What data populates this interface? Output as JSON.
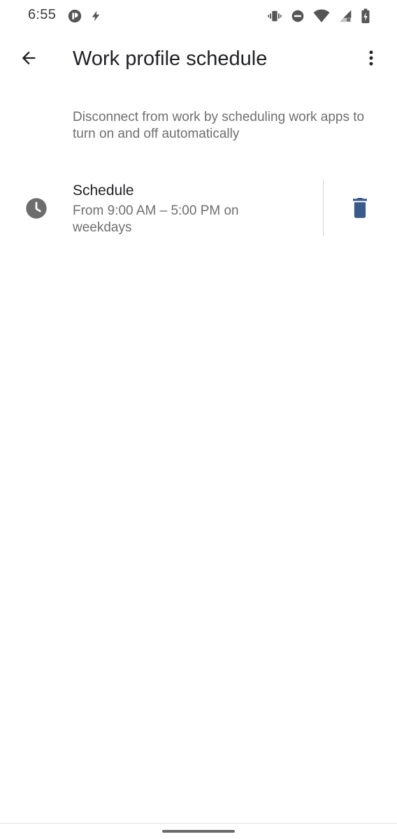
{
  "status_bar": {
    "time": "6:55",
    "left_icons": [
      "app-notification-icon",
      "flash-icon"
    ],
    "right_icons": [
      "vibrate-icon",
      "do-not-disturb-icon",
      "wifi-icon",
      "cell-signal-no-service-icon",
      "battery-charging-icon"
    ]
  },
  "app_bar": {
    "title": "Work profile schedule",
    "back_icon": "arrow-back-icon",
    "overflow_icon": "more-vert-icon"
  },
  "description": "Disconnect from work by scheduling work apps to turn on and off automatically",
  "schedule": {
    "icon": "clock-icon",
    "title": "Schedule",
    "summary": "From 9:00 AM – 5:00 PM on weekdays",
    "delete_icon": "delete-icon"
  },
  "colors": {
    "primary_text": "#202124",
    "secondary_text": "#6f6f6f",
    "accent": "#3a5a8c",
    "icon_gray": "#6d6d6d"
  }
}
